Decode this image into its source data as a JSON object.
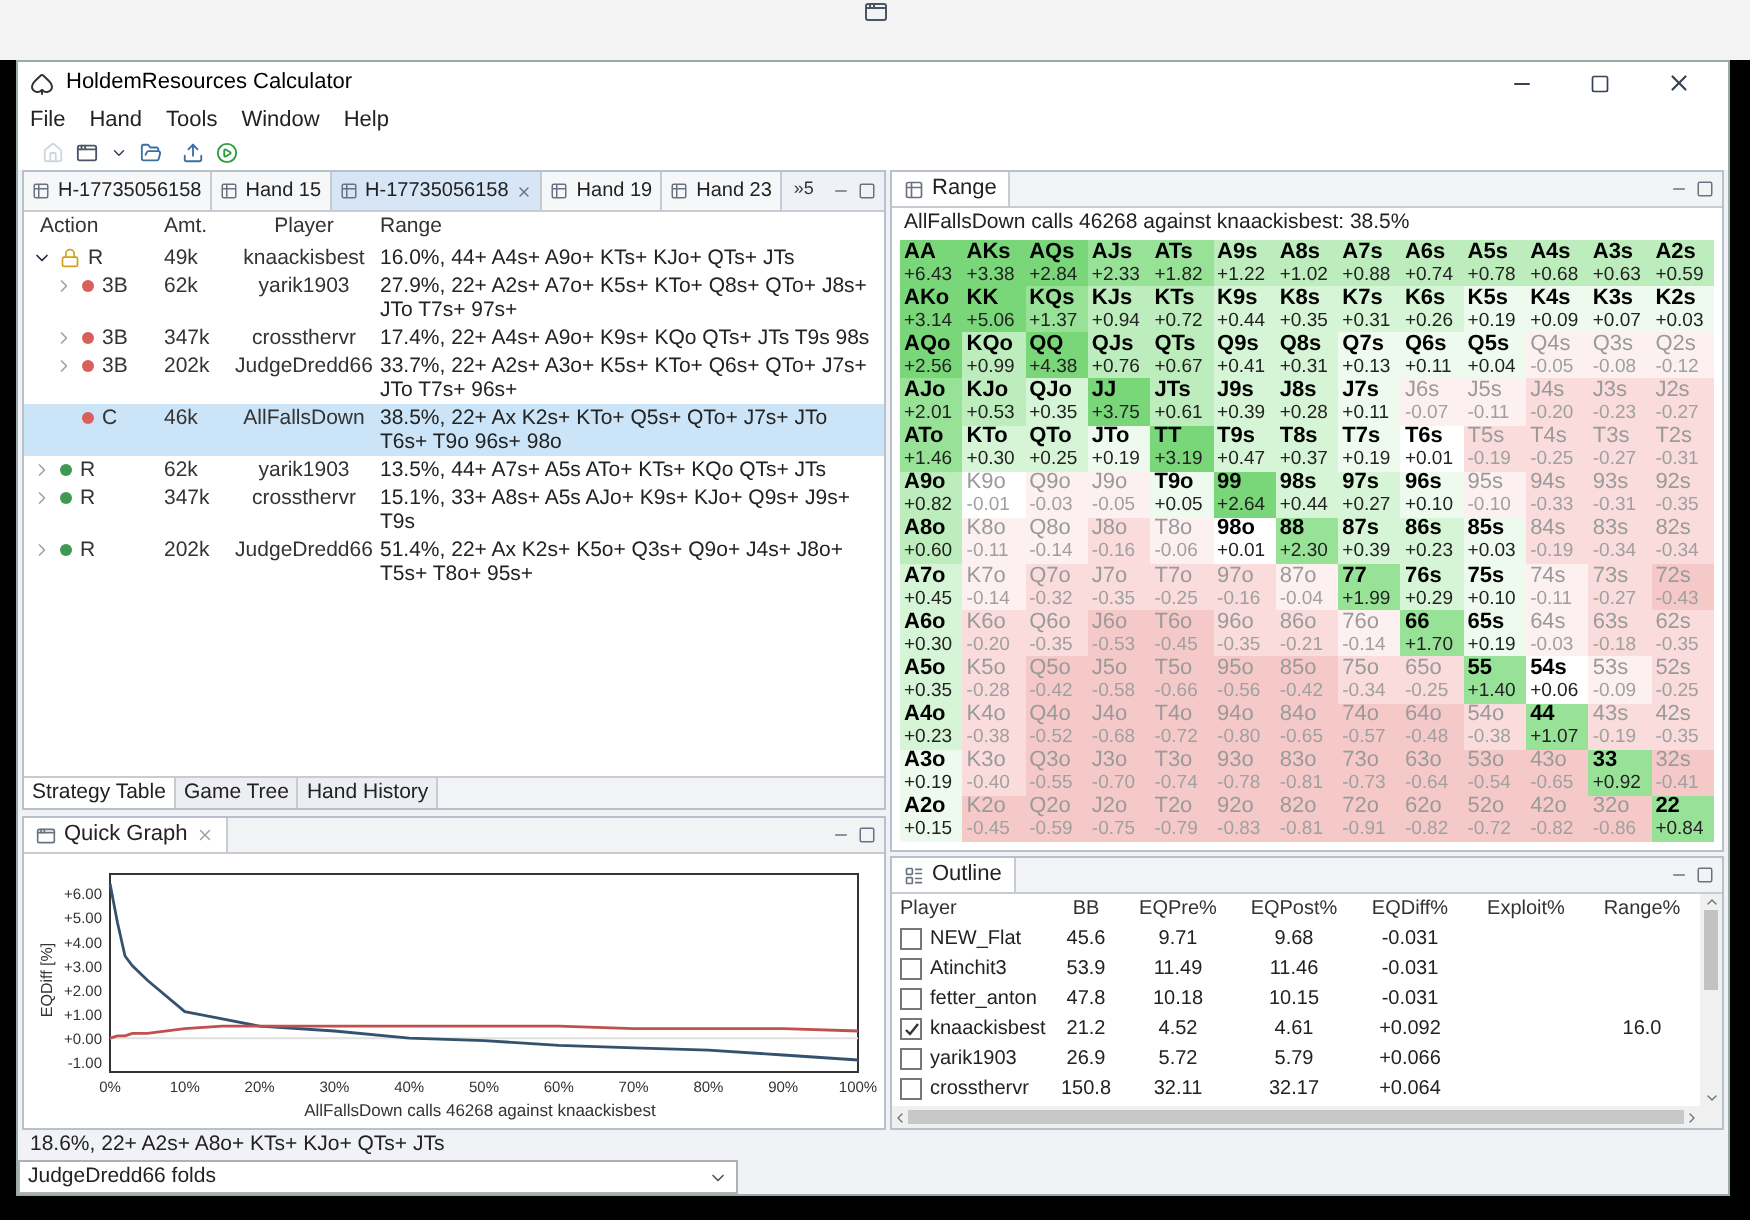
{
  "window": {
    "title": "HoldemResources Calculator"
  },
  "menu": [
    "File",
    "Hand",
    "Tools",
    "Window",
    "Help"
  ],
  "editor_tabs": [
    {
      "label": "H-17735056158",
      "selected": false,
      "closable": false
    },
    {
      "label": "Hand 15",
      "selected": false,
      "closable": false
    },
    {
      "label": "H-17735056158",
      "selected": true,
      "closable": true
    },
    {
      "label": "Hand 19",
      "selected": false,
      "closable": false
    },
    {
      "label": "Hand 23",
      "selected": false,
      "closable": false
    }
  ],
  "tabs_overflow": "»5",
  "strategy_table": {
    "columns": [
      "Action",
      "Amt.",
      "Player",
      "Range"
    ],
    "rows": [
      {
        "action": "R",
        "amount": "49k",
        "player": "knaackisbest",
        "range": "16.0%, 44+ A4s+ A9o+ KTs+ KJo+ QTs+ JTs",
        "kind": "locked",
        "expandable": true,
        "expanded": true,
        "selected": false,
        "children": [
          {
            "action": "3B",
            "amount": "62k",
            "player": "yarik1903",
            "range": "27.9%, 22+ A2s+ A7o+ K5s+ KTo+ Q8s+ QTo+ J8s+ JTo T7s+ 97s+",
            "kind": "dot",
            "color": "#d9605a",
            "expandable": true,
            "expanded": false,
            "selected": false
          },
          {
            "action": "3B",
            "amount": "347k",
            "player": "crossthervr",
            "range": "17.4%, 22+ A4s+ A9o+ K9s+ KQo QTs+ JTs T9s 98s",
            "kind": "dot",
            "color": "#d9605a",
            "expandable": true,
            "expanded": false,
            "selected": false
          },
          {
            "action": "3B",
            "amount": "202k",
            "player": "JudgeDredd66",
            "range": "33.7%, 22+ A2s+ A3o+ K5s+ KTo+ Q6s+ QTo+ J7s+ JTo T7s+ 96s+",
            "kind": "dot",
            "color": "#d9605a",
            "expandable": true,
            "expanded": false,
            "selected": false
          },
          {
            "action": "C",
            "amount": "46k",
            "player": "AllFallsDown",
            "range": "38.5%, 22+ Ax K2s+ KTo+ Q5s+ QTo+ J7s+ JTo T6s+ T9o 96s+ 98o",
            "kind": "dot",
            "color": "#d9605a",
            "expandable": false,
            "selected": true
          }
        ]
      },
      {
        "action": "R",
        "amount": "62k",
        "player": "yarik1903",
        "range": "13.5%, 44+ A7s+ A5s ATo+ KTs+ KQo QTs+ JTs",
        "kind": "dot",
        "color": "#3f9a4f",
        "expandable": true,
        "expanded": false,
        "selected": false
      },
      {
        "action": "R",
        "amount": "347k",
        "player": "crossthervr",
        "range": "15.1%, 33+ A8s+ A5s AJo+ K9s+ KJo+ Q9s+ J9s+ T9s",
        "kind": "dot",
        "color": "#3f9a4f",
        "expandable": true,
        "expanded": false,
        "selected": false
      },
      {
        "action": "R",
        "amount": "202k",
        "player": "JudgeDredd66",
        "range": "51.4%, 22+ Ax K2s+ K5o+ Q3s+ Q9o+ J4s+ J8o+ T5s+ T8o+ 95s+",
        "kind": "dot",
        "color": "#3f9a4f",
        "expandable": true,
        "expanded": false,
        "selected": false
      }
    ]
  },
  "bottom_tabs": [
    {
      "label": "Strategy Table",
      "selected": true
    },
    {
      "label": "Game Tree",
      "selected": false
    },
    {
      "label": "Hand History",
      "selected": false
    }
  ],
  "quick_graph": {
    "title": "Quick Graph",
    "chart_data": {
      "type": "line",
      "xlabel": "AllFallsDown calls 46268 against knaackisbest",
      "ylabel": "EQDiff [%]",
      "x": [
        0,
        1,
        2,
        3,
        5,
        10,
        15,
        20,
        30,
        40,
        50,
        60,
        70,
        80,
        90,
        100
      ],
      "series": [
        {
          "color": "#34526e",
          "values": [
            6.4,
            4.8,
            3.4,
            3.0,
            2.4,
            1.1,
            0.8,
            0.5,
            0.3,
            0.0,
            -0.1,
            -0.3,
            -0.4,
            -0.5,
            -0.7,
            -0.9
          ]
        },
        {
          "color": "#c0504d",
          "values": [
            0.0,
            0.1,
            0.1,
            0.2,
            0.2,
            0.4,
            0.5,
            0.5,
            0.5,
            0.5,
            0.5,
            0.5,
            0.4,
            0.4,
            0.4,
            0.3
          ]
        }
      ],
      "xlim": [
        0,
        100
      ],
      "ylim": [
        -1.4,
        6.8
      ],
      "xticks": [
        {
          "value": 0,
          "label": "0%"
        },
        {
          "value": 10,
          "label": "10%"
        },
        {
          "value": 20,
          "label": "20%"
        },
        {
          "value": 30,
          "label": "30%"
        },
        {
          "value": 40,
          "label": "40%"
        },
        {
          "value": 50,
          "label": "50%"
        },
        {
          "value": 60,
          "label": "60%"
        },
        {
          "value": 70,
          "label": "70%"
        },
        {
          "value": 80,
          "label": "80%"
        },
        {
          "value": 90,
          "label": "90%"
        },
        {
          "value": 100,
          "label": "100%"
        }
      ],
      "yticks": [
        {
          "value": 6,
          "label": "+6.00"
        },
        {
          "value": 5,
          "label": "+5.00"
        },
        {
          "value": 4,
          "label": "+4.00"
        },
        {
          "value": 3,
          "label": "+3.00"
        },
        {
          "value": 2,
          "label": "+2.00"
        },
        {
          "value": 1,
          "label": "+1.00"
        },
        {
          "value": 0,
          "label": "+0.00"
        },
        {
          "value": -1,
          "label": "-1.00"
        }
      ]
    }
  },
  "status": "18.6%, 22+ A2s+ A8o+ KTs+ KJo+ QTs+ JTs",
  "action_select": {
    "value": "JudgeDredd66 folds"
  },
  "range_view": {
    "title": "Range",
    "caption": "AllFallsDown calls 46268 against knaackisbest: 38.5%",
    "rows": [
      [
        {
          "hand": "AA",
          "ev": "+6.43",
          "color": "#79d679",
          "in_range": true
        },
        {
          "hand": "AKs",
          "ev": "+3.38",
          "color": "#79d679",
          "in_range": true
        },
        {
          "hand": "AQs",
          "ev": "+2.84",
          "color": "#79d679",
          "in_range": true
        },
        {
          "hand": "AJs",
          "ev": "+2.33",
          "color": "#98e298",
          "in_range": true
        },
        {
          "hand": "ATs",
          "ev": "+1.82",
          "color": "#98e298",
          "in_range": true
        },
        {
          "hand": "A9s",
          "ev": "+1.22",
          "color": "#bdecbd",
          "in_range": true
        },
        {
          "hand": "A8s",
          "ev": "+1.02",
          "color": "#bdecbd",
          "in_range": true
        },
        {
          "hand": "A7s",
          "ev": "+0.88",
          "color": "#bdecbd",
          "in_range": true
        },
        {
          "hand": "A6s",
          "ev": "+0.74",
          "color": "#bdecbd",
          "in_range": true
        },
        {
          "hand": "A5s",
          "ev": "+0.78",
          "color": "#bdecbd",
          "in_range": true
        },
        {
          "hand": "A4s",
          "ev": "+0.68",
          "color": "#bdecbd",
          "in_range": true
        },
        {
          "hand": "A3s",
          "ev": "+0.63",
          "color": "#bdecbd",
          "in_range": true
        },
        {
          "hand": "A2s",
          "ev": "+0.59",
          "color": "#bdecbd",
          "in_range": true
        }
      ],
      [
        {
          "hand": "AKo",
          "ev": "+3.14",
          "color": "#79d679",
          "in_range": true
        },
        {
          "hand": "KK",
          "ev": "+5.06",
          "color": "#79d679",
          "in_range": true
        },
        {
          "hand": "KQs",
          "ev": "+1.37",
          "color": "#98e298",
          "in_range": true
        },
        {
          "hand": "KJs",
          "ev": "+0.94",
          "color": "#bdecbd",
          "in_range": true
        },
        {
          "hand": "KTs",
          "ev": "+0.72",
          "color": "#bdecbd",
          "in_range": true
        },
        {
          "hand": "K9s",
          "ev": "+0.44",
          "color": "#d6f4d6",
          "in_range": true
        },
        {
          "hand": "K8s",
          "ev": "+0.35",
          "color": "#d6f4d6",
          "in_range": true
        },
        {
          "hand": "K7s",
          "ev": "+0.31",
          "color": "#d6f4d6",
          "in_range": true
        },
        {
          "hand": "K6s",
          "ev": "+0.26",
          "color": "#d6f4d6",
          "in_range": true
        },
        {
          "hand": "K5s",
          "ev": "+0.19",
          "color": "#eefaee",
          "in_range": true
        },
        {
          "hand": "K4s",
          "ev": "+0.09",
          "color": "#eefaee",
          "in_range": true
        },
        {
          "hand": "K3s",
          "ev": "+0.07",
          "color": "#eefaee",
          "in_range": true
        },
        {
          "hand": "K2s",
          "ev": "+0.03",
          "color": "#eefaee",
          "in_range": true
        }
      ],
      [
        {
          "hand": "AQo",
          "ev": "+2.56",
          "color": "#79d679",
          "in_range": true
        },
        {
          "hand": "KQo",
          "ev": "+0.99",
          "color": "#bdecbd",
          "in_range": true
        },
        {
          "hand": "QQ",
          "ev": "+4.38",
          "color": "#79d679",
          "in_range": true
        },
        {
          "hand": "QJs",
          "ev": "+0.76",
          "color": "#bdecbd",
          "in_range": true
        },
        {
          "hand": "QTs",
          "ev": "+0.67",
          "color": "#bdecbd",
          "in_range": true
        },
        {
          "hand": "Q9s",
          "ev": "+0.41",
          "color": "#d6f4d6",
          "in_range": true
        },
        {
          "hand": "Q8s",
          "ev": "+0.31",
          "color": "#d6f4d6",
          "in_range": true
        },
        {
          "hand": "Q7s",
          "ev": "+0.13",
          "color": "#eefaee",
          "in_range": true
        },
        {
          "hand": "Q6s",
          "ev": "+0.11",
          "color": "#eefaee",
          "in_range": true
        },
        {
          "hand": "Q5s",
          "ev": "+0.04",
          "color": "#eefaee",
          "in_range": true
        },
        {
          "hand": "Q4s",
          "ev": "-0.05",
          "color": "#fcf0f0",
          "in_range": false
        },
        {
          "hand": "Q3s",
          "ev": "-0.08",
          "color": "#fcf0f0",
          "in_range": false
        },
        {
          "hand": "Q2s",
          "ev": "-0.12",
          "color": "#fcf0f0",
          "in_range": false
        }
      ],
      [
        {
          "hand": "AJo",
          "ev": "+2.01",
          "color": "#98e298",
          "in_range": true
        },
        {
          "hand": "KJo",
          "ev": "+0.53",
          "color": "#bdecbd",
          "in_range": true
        },
        {
          "hand": "QJo",
          "ev": "+0.35",
          "color": "#d6f4d6",
          "in_range": true
        },
        {
          "hand": "JJ",
          "ev": "+3.75",
          "color": "#79d679",
          "in_range": true
        },
        {
          "hand": "JTs",
          "ev": "+0.61",
          "color": "#bdecbd",
          "in_range": true
        },
        {
          "hand": "J9s",
          "ev": "+0.39",
          "color": "#d6f4d6",
          "in_range": true
        },
        {
          "hand": "J8s",
          "ev": "+0.28",
          "color": "#d6f4d6",
          "in_range": true
        },
        {
          "hand": "J7s",
          "ev": "+0.11",
          "color": "#eefaee",
          "in_range": true
        },
        {
          "hand": "J6s",
          "ev": "-0.07",
          "color": "#fcf0f0",
          "in_range": false
        },
        {
          "hand": "J5s",
          "ev": "-0.11",
          "color": "#fcf0f0",
          "in_range": false
        },
        {
          "hand": "J4s",
          "ev": "-0.20",
          "color": "#fadcdc",
          "in_range": false
        },
        {
          "hand": "J3s",
          "ev": "-0.23",
          "color": "#fadcdc",
          "in_range": false
        },
        {
          "hand": "J2s",
          "ev": "-0.27",
          "color": "#fadcdc",
          "in_range": false
        }
      ],
      [
        {
          "hand": "ATo",
          "ev": "+1.46",
          "color": "#98e298",
          "in_range": true
        },
        {
          "hand": "KTo",
          "ev": "+0.30",
          "color": "#d6f4d6",
          "in_range": true
        },
        {
          "hand": "QTo",
          "ev": "+0.25",
          "color": "#d6f4d6",
          "in_range": true
        },
        {
          "hand": "JTo",
          "ev": "+0.19",
          "color": "#eefaee",
          "in_range": true
        },
        {
          "hand": "TT",
          "ev": "+3.19",
          "color": "#79d679",
          "in_range": true
        },
        {
          "hand": "T9s",
          "ev": "+0.47",
          "color": "#d6f4d6",
          "in_range": true
        },
        {
          "hand": "T8s",
          "ev": "+0.37",
          "color": "#d6f4d6",
          "in_range": true
        },
        {
          "hand": "T7s",
          "ev": "+0.19",
          "color": "#eefaee",
          "in_range": true
        },
        {
          "hand": "T6s",
          "ev": "+0.01",
          "color": "#ffffff",
          "in_range": true
        },
        {
          "hand": "T5s",
          "ev": "-0.19",
          "color": "#fadcdc",
          "in_range": false
        },
        {
          "hand": "T4s",
          "ev": "-0.25",
          "color": "#fadcdc",
          "in_range": false
        },
        {
          "hand": "T3s",
          "ev": "-0.27",
          "color": "#fadcdc",
          "in_range": false
        },
        {
          "hand": "T2s",
          "ev": "-0.31",
          "color": "#fadcdc",
          "in_range": false
        }
      ],
      [
        {
          "hand": "A9o",
          "ev": "+0.82",
          "color": "#bdecbd",
          "in_range": true
        },
        {
          "hand": "K9o",
          "ev": "-0.01",
          "color": "#ffffff",
          "in_range": false
        },
        {
          "hand": "Q9o",
          "ev": "-0.03",
          "color": "#fcf0f0",
          "in_range": false
        },
        {
          "hand": "J9o",
          "ev": "-0.05",
          "color": "#fcf0f0",
          "in_range": false
        },
        {
          "hand": "T9o",
          "ev": "+0.05",
          "color": "#eefaee",
          "in_range": true
        },
        {
          "hand": "99",
          "ev": "+2.64",
          "color": "#79d679",
          "in_range": true
        },
        {
          "hand": "98s",
          "ev": "+0.44",
          "color": "#d6f4d6",
          "in_range": true
        },
        {
          "hand": "97s",
          "ev": "+0.27",
          "color": "#d6f4d6",
          "in_range": true
        },
        {
          "hand": "96s",
          "ev": "+0.10",
          "color": "#eefaee",
          "in_range": true
        },
        {
          "hand": "95s",
          "ev": "-0.10",
          "color": "#fcf0f0",
          "in_range": false
        },
        {
          "hand": "94s",
          "ev": "-0.33",
          "color": "#fadcdc",
          "in_range": false
        },
        {
          "hand": "93s",
          "ev": "-0.31",
          "color": "#fadcdc",
          "in_range": false
        },
        {
          "hand": "92s",
          "ev": "-0.35",
          "color": "#fadcdc",
          "in_range": false
        }
      ],
      [
        {
          "hand": "A8o",
          "ev": "+0.60",
          "color": "#bdecbd",
          "in_range": true
        },
        {
          "hand": "K8o",
          "ev": "-0.11",
          "color": "#fcf0f0",
          "in_range": false
        },
        {
          "hand": "Q8o",
          "ev": "-0.14",
          "color": "#fcf0f0",
          "in_range": false
        },
        {
          "hand": "J8o",
          "ev": "-0.16",
          "color": "#fadcdc",
          "in_range": false
        },
        {
          "hand": "T8o",
          "ev": "-0.06",
          "color": "#fcf0f0",
          "in_range": false
        },
        {
          "hand": "98o",
          "ev": "+0.01",
          "color": "#ffffff",
          "in_range": true
        },
        {
          "hand": "88",
          "ev": "+2.30",
          "color": "#98e298",
          "in_range": true
        },
        {
          "hand": "87s",
          "ev": "+0.39",
          "color": "#d6f4d6",
          "in_range": true
        },
        {
          "hand": "86s",
          "ev": "+0.23",
          "color": "#d6f4d6",
          "in_range": true
        },
        {
          "hand": "85s",
          "ev": "+0.03",
          "color": "#eefaee",
          "in_range": true
        },
        {
          "hand": "84s",
          "ev": "-0.19",
          "color": "#fadcdc",
          "in_range": false
        },
        {
          "hand": "83s",
          "ev": "-0.34",
          "color": "#fadcdc",
          "in_range": false
        },
        {
          "hand": "82s",
          "ev": "-0.34",
          "color": "#fadcdc",
          "in_range": false
        }
      ],
      [
        {
          "hand": "A7o",
          "ev": "+0.45",
          "color": "#d6f4d6",
          "in_range": true
        },
        {
          "hand": "K7o",
          "ev": "-0.14",
          "color": "#fcf0f0",
          "in_range": false
        },
        {
          "hand": "Q7o",
          "ev": "-0.32",
          "color": "#fadcdc",
          "in_range": false
        },
        {
          "hand": "J7o",
          "ev": "-0.35",
          "color": "#fadcdc",
          "in_range": false
        },
        {
          "hand": "T7o",
          "ev": "-0.25",
          "color": "#fadcdc",
          "in_range": false
        },
        {
          "hand": "97o",
          "ev": "-0.16",
          "color": "#fadcdc",
          "in_range": false
        },
        {
          "hand": "87o",
          "ev": "-0.04",
          "color": "#fcf0f0",
          "in_range": false
        },
        {
          "hand": "77",
          "ev": "+1.99",
          "color": "#98e298",
          "in_range": true
        },
        {
          "hand": "76s",
          "ev": "+0.29",
          "color": "#d6f4d6",
          "in_range": true
        },
        {
          "hand": "75s",
          "ev": "+0.10",
          "color": "#eefaee",
          "in_range": true
        },
        {
          "hand": "74s",
          "ev": "-0.11",
          "color": "#fcf0f0",
          "in_range": false
        },
        {
          "hand": "73s",
          "ev": "-0.27",
          "color": "#fadcdc",
          "in_range": false
        },
        {
          "hand": "72s",
          "ev": "-0.43",
          "color": "#f6c9c9",
          "in_range": false
        }
      ],
      [
        {
          "hand": "A6o",
          "ev": "+0.30",
          "color": "#d6f4d6",
          "in_range": true
        },
        {
          "hand": "K6o",
          "ev": "-0.20",
          "color": "#fadcdc",
          "in_range": false
        },
        {
          "hand": "Q6o",
          "ev": "-0.35",
          "color": "#fadcdc",
          "in_range": false
        },
        {
          "hand": "J6o",
          "ev": "-0.53",
          "color": "#f6c9c9",
          "in_range": false
        },
        {
          "hand": "T6o",
          "ev": "-0.45",
          "color": "#f6c9c9",
          "in_range": false
        },
        {
          "hand": "96o",
          "ev": "-0.35",
          "color": "#fadcdc",
          "in_range": false
        },
        {
          "hand": "86o",
          "ev": "-0.21",
          "color": "#fadcdc",
          "in_range": false
        },
        {
          "hand": "76o",
          "ev": "-0.14",
          "color": "#fcf0f0",
          "in_range": false
        },
        {
          "hand": "66",
          "ev": "+1.70",
          "color": "#98e298",
          "in_range": true
        },
        {
          "hand": "65s",
          "ev": "+0.19",
          "color": "#eefaee",
          "in_range": true
        },
        {
          "hand": "64s",
          "ev": "-0.03",
          "color": "#fcf0f0",
          "in_range": false
        },
        {
          "hand": "63s",
          "ev": "-0.18",
          "color": "#fadcdc",
          "in_range": false
        },
        {
          "hand": "62s",
          "ev": "-0.35",
          "color": "#fadcdc",
          "in_range": false
        }
      ],
      [
        {
          "hand": "A5o",
          "ev": "+0.35",
          "color": "#d6f4d6",
          "in_range": true
        },
        {
          "hand": "K5o",
          "ev": "-0.28",
          "color": "#fadcdc",
          "in_range": false
        },
        {
          "hand": "Q5o",
          "ev": "-0.42",
          "color": "#f6c9c9",
          "in_range": false
        },
        {
          "hand": "J5o",
          "ev": "-0.58",
          "color": "#f6c9c9",
          "in_range": false
        },
        {
          "hand": "T5o",
          "ev": "-0.66",
          "color": "#f6c9c9",
          "in_range": false
        },
        {
          "hand": "95o",
          "ev": "-0.56",
          "color": "#f6c9c9",
          "in_range": false
        },
        {
          "hand": "85o",
          "ev": "-0.42",
          "color": "#f6c9c9",
          "in_range": false
        },
        {
          "hand": "75o",
          "ev": "-0.34",
          "color": "#fadcdc",
          "in_range": false
        },
        {
          "hand": "65o",
          "ev": "-0.25",
          "color": "#fadcdc",
          "in_range": false
        },
        {
          "hand": "55",
          "ev": "+1.40",
          "color": "#98e298",
          "in_range": true
        },
        {
          "hand": "54s",
          "ev": "+0.06",
          "color": "#ffffff",
          "in_range": true
        },
        {
          "hand": "53s",
          "ev": "-0.09",
          "color": "#fcf0f0",
          "in_range": false
        },
        {
          "hand": "52s",
          "ev": "-0.25",
          "color": "#fadcdc",
          "in_range": false
        }
      ],
      [
        {
          "hand": "A4o",
          "ev": "+0.23",
          "color": "#d6f4d6",
          "in_range": true
        },
        {
          "hand": "K4o",
          "ev": "-0.38",
          "color": "#fadcdc",
          "in_range": false
        },
        {
          "hand": "Q4o",
          "ev": "-0.52",
          "color": "#f6c9c9",
          "in_range": false
        },
        {
          "hand": "J4o",
          "ev": "-0.68",
          "color": "#f6c9c9",
          "in_range": false
        },
        {
          "hand": "T4o",
          "ev": "-0.72",
          "color": "#f6c9c9",
          "in_range": false
        },
        {
          "hand": "94o",
          "ev": "-0.80",
          "color": "#f6c9c9",
          "in_range": false
        },
        {
          "hand": "84o",
          "ev": "-0.65",
          "color": "#f6c9c9",
          "in_range": false
        },
        {
          "hand": "74o",
          "ev": "-0.57",
          "color": "#f6c9c9",
          "in_range": false
        },
        {
          "hand": "64o",
          "ev": "-0.48",
          "color": "#f6c9c9",
          "in_range": false
        },
        {
          "hand": "54o",
          "ev": "-0.38",
          "color": "#fadcdc",
          "in_range": false
        },
        {
          "hand": "44",
          "ev": "+1.07",
          "color": "#98e298",
          "in_range": true
        },
        {
          "hand": "43s",
          "ev": "-0.19",
          "color": "#fadcdc",
          "in_range": false
        },
        {
          "hand": "42s",
          "ev": "-0.35",
          "color": "#fadcdc",
          "in_range": false
        }
      ],
      [
        {
          "hand": "A3o",
          "ev": "+0.19",
          "color": "#eefaee",
          "in_range": true
        },
        {
          "hand": "K3o",
          "ev": "-0.40",
          "color": "#fadcdc",
          "in_range": false
        },
        {
          "hand": "Q3o",
          "ev": "-0.55",
          "color": "#f6c9c9",
          "in_range": false
        },
        {
          "hand": "J3o",
          "ev": "-0.70",
          "color": "#f6c9c9",
          "in_range": false
        },
        {
          "hand": "T3o",
          "ev": "-0.74",
          "color": "#f6c9c9",
          "in_range": false
        },
        {
          "hand": "93o",
          "ev": "-0.78",
          "color": "#f6c9c9",
          "in_range": false
        },
        {
          "hand": "83o",
          "ev": "-0.81",
          "color": "#f6c9c9",
          "in_range": false
        },
        {
          "hand": "73o",
          "ev": "-0.73",
          "color": "#f6c9c9",
          "in_range": false
        },
        {
          "hand": "63o",
          "ev": "-0.64",
          "color": "#f6c9c9",
          "in_range": false
        },
        {
          "hand": "53o",
          "ev": "-0.54",
          "color": "#f6c9c9",
          "in_range": false
        },
        {
          "hand": "43o",
          "ev": "-0.65",
          "color": "#f6c9c9",
          "in_range": false
        },
        {
          "hand": "33",
          "ev": "+0.92",
          "color": "#98e298",
          "in_range": true
        },
        {
          "hand": "32s",
          "ev": "-0.41",
          "color": "#f6c9c9",
          "in_range": false
        }
      ],
      [
        {
          "hand": "A2o",
          "ev": "+0.15",
          "color": "#eefaee",
          "in_range": true
        },
        {
          "hand": "K2o",
          "ev": "-0.45",
          "color": "#f6c9c9",
          "in_range": false
        },
        {
          "hand": "Q2o",
          "ev": "-0.59",
          "color": "#f6c9c9",
          "in_range": false
        },
        {
          "hand": "J2o",
          "ev": "-0.75",
          "color": "#f6c9c9",
          "in_range": false
        },
        {
          "hand": "T2o",
          "ev": "-0.79",
          "color": "#f6c9c9",
          "in_range": false
        },
        {
          "hand": "92o",
          "ev": "-0.83",
          "color": "#f6c9c9",
          "in_range": false
        },
        {
          "hand": "82o",
          "ev": "-0.81",
          "color": "#f6c9c9",
          "in_range": false
        },
        {
          "hand": "72o",
          "ev": "-0.91",
          "color": "#f6c9c9",
          "in_range": false
        },
        {
          "hand": "62o",
          "ev": "-0.82",
          "color": "#f6c9c9",
          "in_range": false
        },
        {
          "hand": "52o",
          "ev": "-0.72",
          "color": "#f6c9c9",
          "in_range": false
        },
        {
          "hand": "42o",
          "ev": "-0.82",
          "color": "#f6c9c9",
          "in_range": false
        },
        {
          "hand": "32o",
          "ev": "-0.86",
          "color": "#f6c9c9",
          "in_range": false
        },
        {
          "hand": "22",
          "ev": "+0.84",
          "color": "#98e298",
          "in_range": true
        }
      ]
    ]
  },
  "outline": {
    "title": "Outline",
    "columns": [
      "Player",
      "BB",
      "EQPre%",
      "EQPost%",
      "EQDiff%",
      "Exploit%",
      "Range%"
    ],
    "rows": [
      {
        "player": "NEW_Flat",
        "checked": false,
        "bb": "45.6",
        "eq_pre": "9.71",
        "eq_post": "9.68",
        "eq_diff": "-0.031"
      },
      {
        "player": "Atinchit3",
        "checked": false,
        "bb": "53.9",
        "eq_pre": "11.49",
        "eq_post": "11.46",
        "eq_diff": "-0.031"
      },
      {
        "player": "fetter_anton",
        "checked": false,
        "bb": "47.8",
        "eq_pre": "10.18",
        "eq_post": "10.15",
        "eq_diff": "-0.031"
      },
      {
        "player": "knaackisbest",
        "checked": true,
        "bb": "21.2",
        "eq_pre": "4.52",
        "eq_post": "4.61",
        "eq_diff": "+0.092",
        "range": "16.0"
      },
      {
        "player": "yarik1903",
        "checked": false,
        "bb": "26.9",
        "eq_pre": "5.72",
        "eq_post": "5.79",
        "eq_diff": "+0.066"
      },
      {
        "player": "crossthervr",
        "checked": false,
        "bb": "150.8",
        "eq_pre": "32.11",
        "eq_post": "32.17",
        "eq_diff": "+0.064"
      }
    ]
  }
}
